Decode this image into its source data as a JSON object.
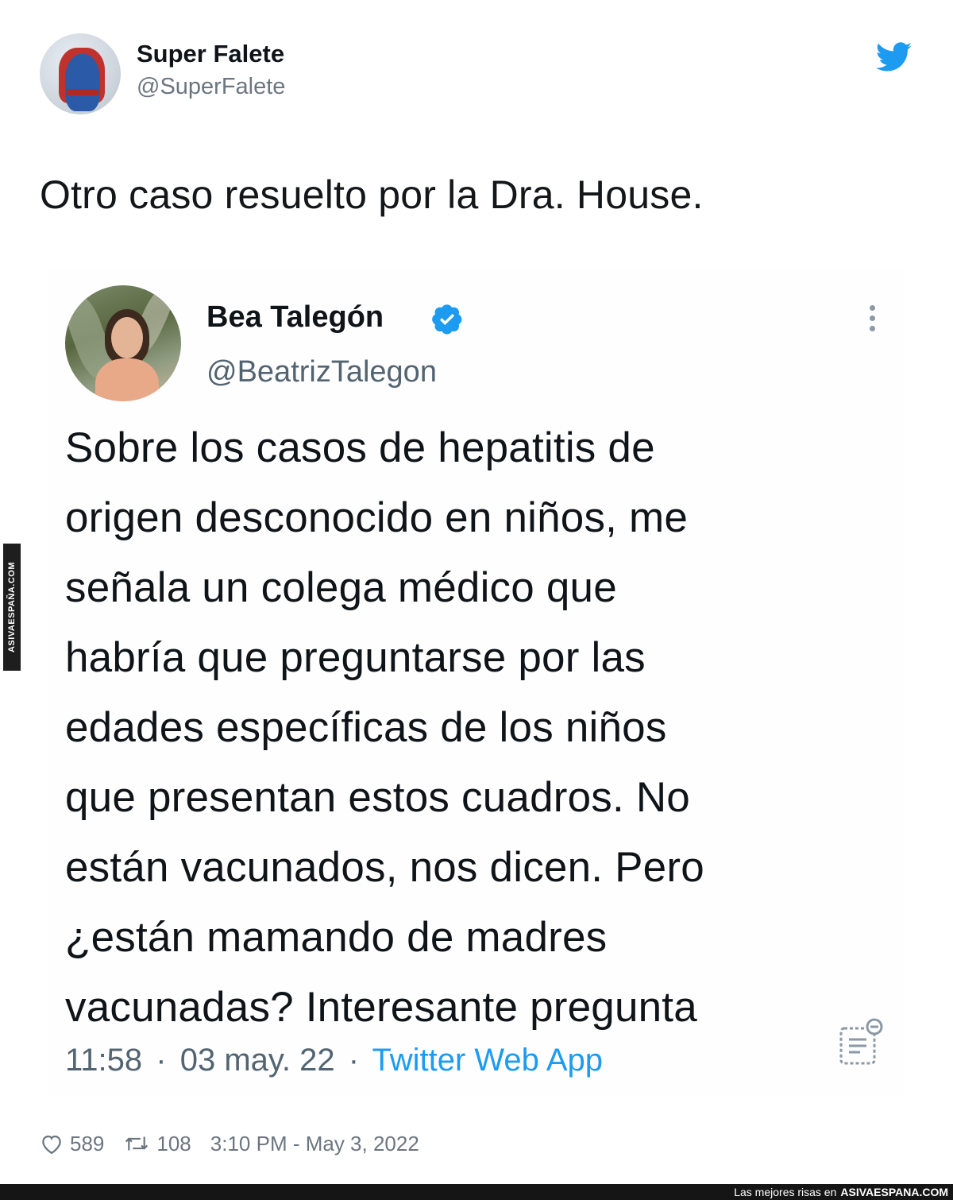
{
  "outer_tweet": {
    "name": "Super Falete",
    "handle": "@SuperFalete",
    "text": "Otro caso resuelto por la Dra. House."
  },
  "quoted_tweet": {
    "name": "Bea Talegón",
    "handle": "@BeatrizTalegon",
    "text_lines": [
      "Sobre los casos de hepatitis de",
      "origen desconocido en niños, me",
      "señala un colega médico que",
      "habría que preguntarse por las",
      "edades específicas de los niños",
      "que presentan estos cuadros. No",
      "están vacunados, nos dicen. Pero",
      "¿están mamando de madres",
      "vacunadas? Interesante pregunta"
    ],
    "time": "11:58",
    "date": "03 may. 22",
    "separator": "·",
    "source": "Twitter Web App"
  },
  "stats": {
    "likes": "589",
    "retweets": "108",
    "timestamp": "3:10 PM - May 3, 2022"
  },
  "watermark": {
    "side": "ASIVAESPAÑA.COM",
    "bottom_text": "Las mejores risas en",
    "bottom_site": "ASIVAESPANA.COM"
  },
  "colors": {
    "twitter_blue": "#1d9bf0",
    "verified_blue": "#1d9bf0",
    "secondary_text": "#536471"
  },
  "icons": [
    "twitter-bird-icon",
    "verified-badge-icon",
    "more-options-icon",
    "analytics-icon",
    "heart-icon",
    "retweet-icon"
  ]
}
